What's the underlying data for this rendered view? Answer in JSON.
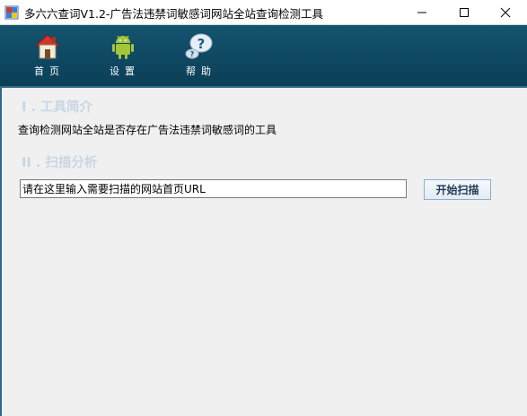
{
  "window": {
    "title": "多六六查词V1.2-广告法违禁词敏感词网站全站查询检测工具"
  },
  "toolbar": {
    "items": [
      {
        "label": "首页",
        "icon": "home-icon"
      },
      {
        "label": "设置",
        "icon": "android-icon"
      },
      {
        "label": "帮助",
        "icon": "help-icon"
      }
    ]
  },
  "sections": {
    "intro_title": "I . 工具简介",
    "intro_text": "查询检测网站全站是否存在广告法违禁词敏感词的工具",
    "scan_title": "II . 扫描分析"
  },
  "scan": {
    "url_value": "请在这里输入需要扫描的网站首页URL",
    "button_label": "开始扫描"
  },
  "colors": {
    "toolbar_bg": "#0f4862",
    "section_title": "#c9d6e3"
  }
}
